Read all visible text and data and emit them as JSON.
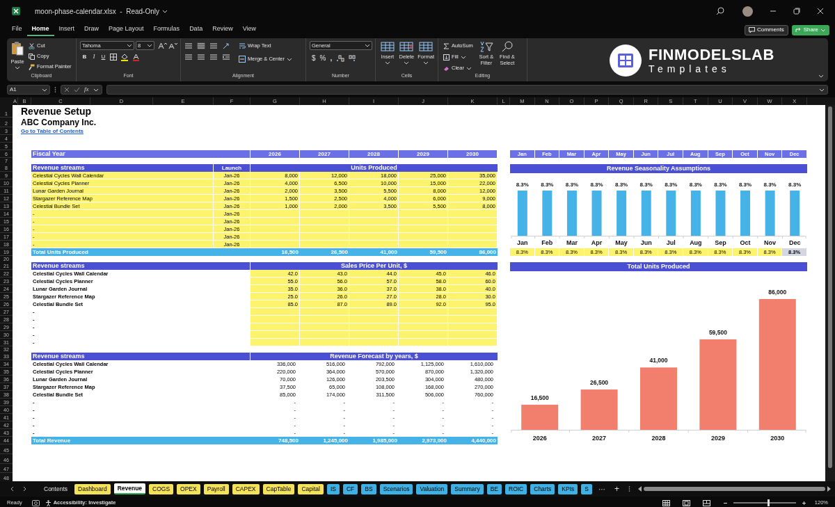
{
  "window": {
    "title": "moon-phase-calendar.xlsx  -  Read-Only"
  },
  "menu": [
    {
      "label": "File",
      "selected": false
    },
    {
      "label": "Home",
      "selected": true
    },
    {
      "label": "Insert",
      "selected": false
    },
    {
      "label": "Draw",
      "selected": false
    },
    {
      "label": "Page Layout",
      "selected": false
    },
    {
      "label": "Formulas",
      "selected": false
    },
    {
      "label": "Data",
      "selected": false
    },
    {
      "label": "Review",
      "selected": false
    },
    {
      "label": "View",
      "selected": false
    }
  ],
  "header_buttons": {
    "comments": "Comments",
    "share": "Share"
  },
  "ribbon": {
    "clipboard": {
      "paste": "Paste",
      "cut": "Cut",
      "copy": "Copy",
      "format_painter": "Format Painter",
      "label": "Clipboard"
    },
    "font": {
      "name": "Tahoma",
      "size": "8",
      "bold": "B",
      "italic": "I",
      "underline": "U",
      "label": "Font"
    },
    "alignment": {
      "wrap": "Wrap Text",
      "merge": "Merge & Center",
      "label": "Alignment"
    },
    "number": {
      "format": "General",
      "currency": "$",
      "percent": "%",
      "comma": ",",
      "label": "Number"
    },
    "cells": {
      "buttons": [
        "Insert",
        "Delete",
        "Format"
      ],
      "label": "Cells"
    },
    "editing": {
      "autosum": "AutoSum",
      "fill": "Fill",
      "clear": "Clear",
      "sort": "Sort & Filter",
      "find": "Find & Select",
      "label": "Editing"
    }
  },
  "logo": {
    "name": "FINMODELSLAB",
    "subtitle": "Templates"
  },
  "formula_bar": {
    "name_box": "A1",
    "function_label": "fx"
  },
  "column_headers": [
    "A",
    "B",
    "C",
    "D",
    "E",
    "F",
    "G",
    "H",
    "I",
    "J",
    "K",
    "L",
    "M",
    "N",
    "O",
    "P",
    "Q",
    "R",
    "S",
    "T",
    "U",
    "V",
    "W",
    "X"
  ],
  "row_numbers": [
    "1",
    "2",
    "3",
    "4",
    "5",
    "6",
    "7",
    "8",
    "9",
    "10",
    "11",
    "12",
    "13",
    "14",
    "15",
    "16",
    "17",
    "18",
    "19",
    "20",
    "21",
    "22",
    "23",
    "24",
    "25",
    "26",
    "27",
    "28",
    "29",
    "30",
    "31",
    "32",
    "33",
    "34",
    "35",
    "36",
    "37",
    "38",
    "39",
    "40",
    "41",
    "42",
    "43",
    "44",
    "45",
    "46",
    "47",
    "48"
  ],
  "sheet": {
    "title": "Revenue Setup",
    "company": "ABC Company Inc.",
    "link": "Go to Table of Contents",
    "fiscal_year": {
      "label": "Fiscal Year",
      "years": [
        "2026",
        "2027",
        "2028",
        "2029",
        "2030"
      ]
    },
    "units_table": {
      "columns": [
        "Revenue streams",
        "Launch"
      ],
      "title": "Units Produced",
      "rows": [
        {
          "name": "Celestial Cycles Wall Calendar",
          "launch": "Jan-26",
          "values": [
            "8,000",
            "12,000",
            "18,000",
            "25,000",
            "35,000"
          ]
        },
        {
          "name": "Celestial Cycles Planner",
          "launch": "Jan-26",
          "values": [
            "4,000",
            "6,500",
            "10,000",
            "15,000",
            "22,000"
          ]
        },
        {
          "name": "Lunar Garden Journal",
          "launch": "Jan-26",
          "values": [
            "2,000",
            "3,500",
            "5,500",
            "8,000",
            "12,000"
          ]
        },
        {
          "name": "Stargazer Reference Map",
          "launch": "Jan-26",
          "values": [
            "1,500",
            "2,500",
            "4,000",
            "6,000",
            "9,000"
          ]
        },
        {
          "name": "Celestial Bundle Set",
          "launch": "Jan-26",
          "values": [
            "1,000",
            "2,000",
            "3,500",
            "5,500",
            "8,000"
          ]
        },
        {
          "name": "-",
          "launch": "Jan-26"
        },
        {
          "name": "-",
          "launch": "Jan-26"
        },
        {
          "name": "-",
          "launch": "Jan-26"
        },
        {
          "name": "-",
          "launch": "Jan-26"
        },
        {
          "name": "-",
          "launch": "Jan-26"
        }
      ],
      "total": {
        "label": "Total Units Produced",
        "values": [
          "16,500",
          "26,500",
          "41,000",
          "59,500",
          "86,000"
        ]
      }
    },
    "price_table": {
      "columns": [
        "Revenue streams"
      ],
      "title": "Sales Price Per Unit, $",
      "rows": [
        {
          "name": "Celestial Cycles Wall Calendar",
          "values": [
            "42.0",
            "43.0",
            "44.0",
            "45.0",
            "46.0"
          ]
        },
        {
          "name": "Celestial Cycles Planner",
          "values": [
            "55.0",
            "56.0",
            "57.0",
            "58.0",
            "60.0"
          ]
        },
        {
          "name": "Lunar Garden Journal",
          "values": [
            "35.0",
            "36.0",
            "37.0",
            "38.0",
            "40.0"
          ]
        },
        {
          "name": "Stargazer Reference Map",
          "values": [
            "25.0",
            "26.0",
            "27.0",
            "28.0",
            "30.0"
          ]
        },
        {
          "name": "Celestial Bundle Set",
          "values": [
            "85.0",
            "87.0",
            "89.0",
            "92.0",
            "95.0"
          ]
        },
        {
          "name": "-"
        },
        {
          "name": "-"
        },
        {
          "name": "-"
        },
        {
          "name": "-"
        },
        {
          "name": "-"
        }
      ]
    },
    "revenue_table": {
      "columns": [
        "Revenue streams"
      ],
      "title": "Revenue Forecast by years, $",
      "rows": [
        {
          "name": "Celestial Cycles Wall Calendar",
          "values": [
            "336,000",
            "516,000",
            "792,000",
            "1,125,000",
            "1,610,000"
          ]
        },
        {
          "name": "Celestial Cycles Planner",
          "values": [
            "220,000",
            "364,000",
            "570,000",
            "870,000",
            "1,320,000"
          ]
        },
        {
          "name": "Lunar Garden Journal",
          "values": [
            "70,000",
            "126,000",
            "203,500",
            "304,000",
            "480,000"
          ]
        },
        {
          "name": "Stargazer Reference Map",
          "values": [
            "37,500",
            "65,000",
            "108,000",
            "168,000",
            "270,000"
          ]
        },
        {
          "name": "Celestial Bundle Set",
          "values": [
            "85,000",
            "174,000",
            "311,500",
            "506,000",
            "760,000"
          ]
        },
        {
          "name": "-",
          "values": [
            "-",
            "-",
            "-",
            "-",
            "-"
          ]
        },
        {
          "name": "-",
          "values": [
            "-",
            "-",
            "-",
            "-",
            "-"
          ]
        },
        {
          "name": "-",
          "values": [
            "-",
            "-",
            "-",
            "-",
            "-"
          ]
        },
        {
          "name": "-",
          "values": [
            "-",
            "-",
            "-",
            "-",
            "-"
          ]
        },
        {
          "name": "-",
          "values": [
            "-",
            "-",
            "-",
            "-",
            "-"
          ]
        }
      ],
      "total": {
        "label": "Total Revenue",
        "values": [
          "748,500",
          "1,245,000",
          "1,985,000",
          "2,973,000",
          "4,440,000"
        ]
      }
    },
    "months": [
      "Jan",
      "Feb",
      "Mar",
      "Apr",
      "May",
      "Jun",
      "Jul",
      "Aug",
      "Sep",
      "Oct",
      "Nov",
      "Dec"
    ],
    "seasonality_chart": {
      "chart_data": {
        "type": "bar",
        "title": "Revenue Seasonality Assumptions",
        "categories": [
          "Jan",
          "Feb",
          "Mar",
          "Apr",
          "May",
          "Jun",
          "Jul",
          "Aug",
          "Sep",
          "Oct",
          "Nov",
          "Dec"
        ],
        "values": [
          8.3,
          8.3,
          8.3,
          8.3,
          8.3,
          8.3,
          8.3,
          8.3,
          8.3,
          8.3,
          8.3,
          8.3
        ],
        "value_labels": [
          "8.3%",
          "8.3%",
          "8.3%",
          "8.3%",
          "8.3%",
          "8.3%",
          "8.3%",
          "8.3%",
          "8.3%",
          "8.3%",
          "8.3%",
          "8.3%"
        ]
      }
    },
    "seasonality_inputs": [
      {
        "value": "8.3%",
        "kind": "input"
      },
      {
        "value": "8.3%",
        "kind": "input"
      },
      {
        "value": "8.3%",
        "kind": "input"
      },
      {
        "value": "8.3%",
        "kind": "input"
      },
      {
        "value": "8.3%",
        "kind": "input"
      },
      {
        "value": "8.3%",
        "kind": "input"
      },
      {
        "value": "8.3%",
        "kind": "input"
      },
      {
        "value": "8.3%",
        "kind": "input"
      },
      {
        "value": "8.3%",
        "kind": "input"
      },
      {
        "value": "8.3%",
        "kind": "input"
      },
      {
        "value": "8.3%",
        "kind": "input"
      },
      {
        "value": "8.3%",
        "kind": "formula"
      }
    ],
    "units_chart": {
      "chart_data": {
        "type": "bar",
        "title": "Total Units Produced",
        "categories": [
          "2026",
          "2027",
          "2028",
          "2029",
          "2030"
        ],
        "values": [
          16500,
          26500,
          41000,
          59500,
          86000
        ],
        "value_labels": [
          "16,500",
          "26,500",
          "41,000",
          "59,500",
          "86,000"
        ]
      }
    }
  },
  "sheet_tabs": [
    {
      "label": "Contents",
      "selected": false
    },
    {
      "label": "Dashboard",
      "selected": false,
      "color": "#f5e25b"
    },
    {
      "label": "Revenue",
      "selected": true
    },
    {
      "label": "COGS",
      "selected": false,
      "color": "#f5e25b"
    },
    {
      "label": "OPEX",
      "selected": false,
      "color": "#f5e25b"
    },
    {
      "label": "Payroll",
      "selected": false,
      "color": "#f5e25b"
    },
    {
      "label": "CAPEX",
      "selected": false,
      "color": "#f5e25b"
    },
    {
      "label": "CapTable",
      "selected": false,
      "color": "#f5e25b"
    },
    {
      "label": "Capital",
      "selected": false,
      "color": "#f5e25b"
    },
    {
      "label": "IS",
      "selected": false,
      "color": "#3fb0e4"
    },
    {
      "label": "CF",
      "selected": false,
      "color": "#3fb0e4"
    },
    {
      "label": "BS",
      "selected": false,
      "color": "#3fb0e4"
    },
    {
      "label": "Scenarios",
      "selected": false,
      "color": "#3fb0e4"
    },
    {
      "label": "Valuation",
      "selected": false,
      "color": "#3fb0e4"
    },
    {
      "label": "Summary",
      "selected": false,
      "color": "#3fb0e4"
    },
    {
      "label": "BE",
      "selected": false,
      "color": "#3fb0e4"
    },
    {
      "label": "ROIC",
      "selected": false,
      "color": "#3fb0e4"
    },
    {
      "label": "Charts",
      "selected": false,
      "color": "#3fb0e4"
    },
    {
      "label": "KPIs",
      "selected": false,
      "color": "#3fb0e4"
    },
    {
      "label": "S",
      "selected": false,
      "color": "#3fb0e4"
    }
  ],
  "tab_controls": {
    "more": "···",
    "add": "+"
  },
  "status_bar": {
    "status": "Ready",
    "accessibility": "Accessibility: Investigate",
    "zoom": "120%",
    "zoom_level": {
      "level": 0.55
    }
  }
}
